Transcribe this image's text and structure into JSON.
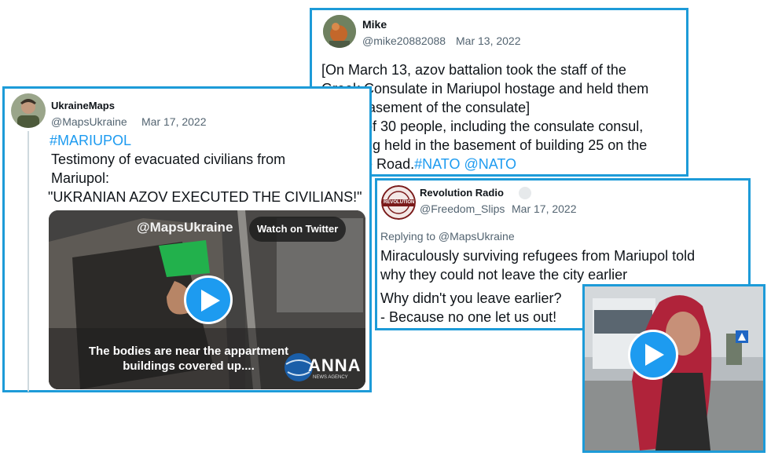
{
  "tweet_mike": {
    "name": "Mike",
    "handle": "@mike20882088",
    "date": "Mar 13, 2022",
    "lines": [
      "[On March 13, azov battalion took the staff of the",
      "Greek Consulate in Mariupol hostage and held them",
      "in the basement of the consulate]",
      "A total of 30 people, including the consulate consul,",
      "are being held in the basement of building 25 on the",
      "Seaside Road."
    ],
    "hashtags": "#NATO @NATO"
  },
  "tweet_ukrainemaps": {
    "name": "UkraineMaps",
    "handle": "@MapsUkraine",
    "date": "Mar 17, 2022",
    "hashtag": "#MARIUPOL",
    "lines": [
      "Testimony of evacuated civilians from",
      "Mariupol:",
      "\"UKRANIAN AZOV EXECUTED THE CIVILIANS!\""
    ],
    "video": {
      "watermark": "@MapsUkraine",
      "watch_label": "Watch on Twitter",
      "caption_line1": "The bodies are near the appartment",
      "caption_line2": "buildings covered up....",
      "logo": "ANNA",
      "logo_sub": "NEWS AGENCY"
    }
  },
  "tweet_revolution": {
    "name": "Revolution Radio",
    "handle": "@Freedom_Slips",
    "date": "Mar 17, 2022",
    "replying": "Replying to @MapsUkraine",
    "lines": [
      "Miraculously surviving refugees from Mariupol told",
      "why they could not leave the city earlier"
    ],
    "dialog": [
      "Why didn't you leave earlier?",
      "- Because no one let us out!"
    ],
    "avatar_text": "REVOLUTION"
  },
  "colors": {
    "border": "#1d9bd8",
    "hashtag": "#1d9bf0",
    "meta": "#536471"
  }
}
